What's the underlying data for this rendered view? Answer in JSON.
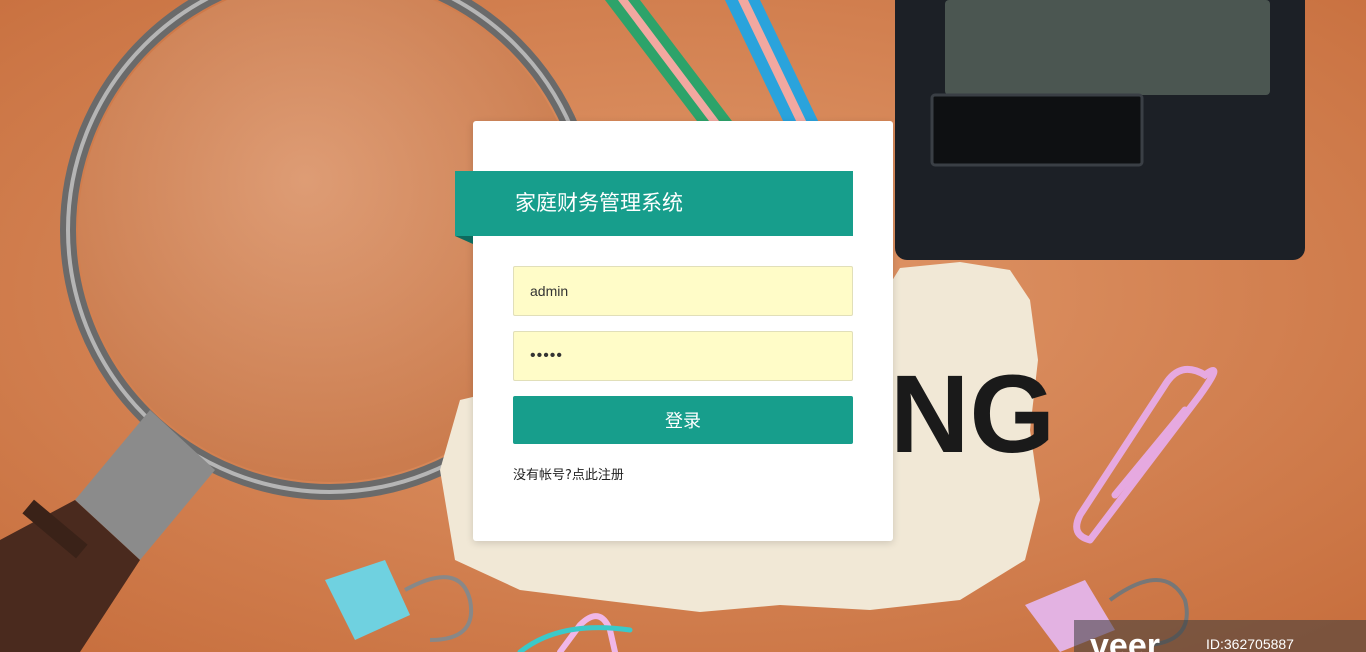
{
  "login": {
    "title": "家庭财务管理系统",
    "username_value": "admin",
    "password_value": "•••••",
    "login_button_label": "登录",
    "register_link_text": "没有帐号?点此注册"
  },
  "watermark": {
    "logo_text": "veer",
    "id_text": "ID:362705887"
  },
  "theme": {
    "accent": "#179e8c",
    "input_background": "#fffcc8",
    "card_background": "#ffffff"
  },
  "icons": {
    "background": "desk-photo-magnifier-calculator-paperclips"
  }
}
